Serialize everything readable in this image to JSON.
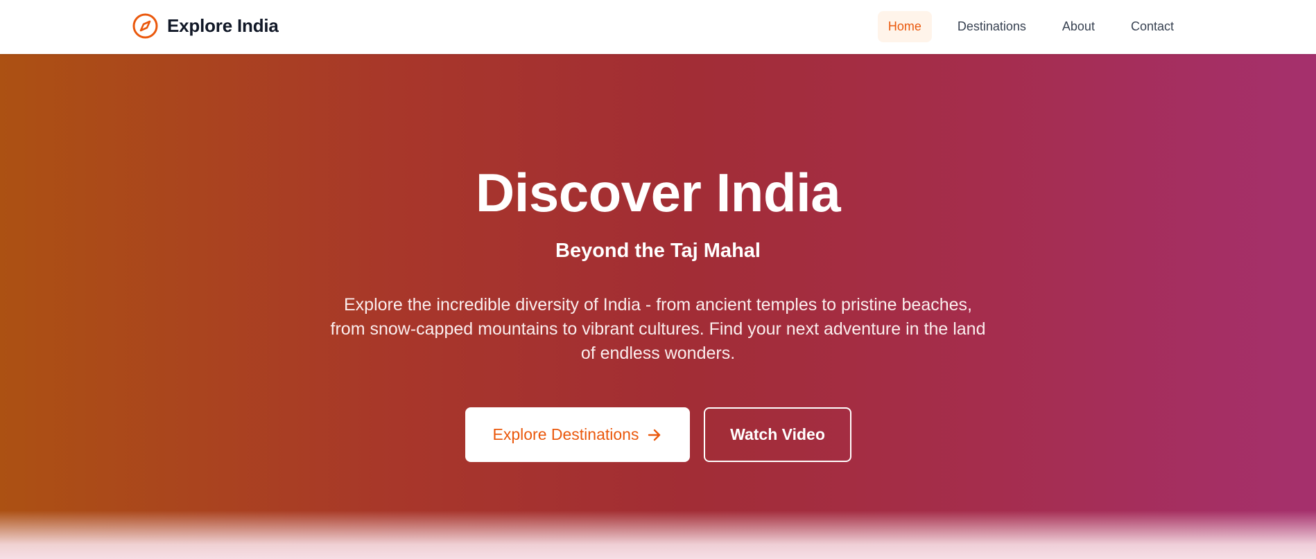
{
  "nav": {
    "brand": "Explore India",
    "brand_icon": "compass-icon",
    "links": [
      {
        "label": "Home",
        "active": true
      },
      {
        "label": "Destinations",
        "active": false
      },
      {
        "label": "About",
        "active": false
      },
      {
        "label": "Contact",
        "active": false
      }
    ]
  },
  "hero": {
    "title": "Discover India",
    "subtitle": "Beyond the Taj Mahal",
    "description": "Explore the incredible diversity of India - from ancient temples to pristine beaches, from snow-capped mountains to vibrant cultures. Find your next adventure in the land of endless wonders.",
    "primary_button": "Explore Destinations",
    "primary_button_icon": "arrow-right-icon",
    "secondary_button": "Watch Video"
  },
  "colors": {
    "accent": "#ea580c",
    "nav_text": "#374151",
    "brand_text": "#111827",
    "gradient_start": "#ac5113",
    "gradient_mid": "#a22d35",
    "gradient_end": "#a5306d"
  }
}
